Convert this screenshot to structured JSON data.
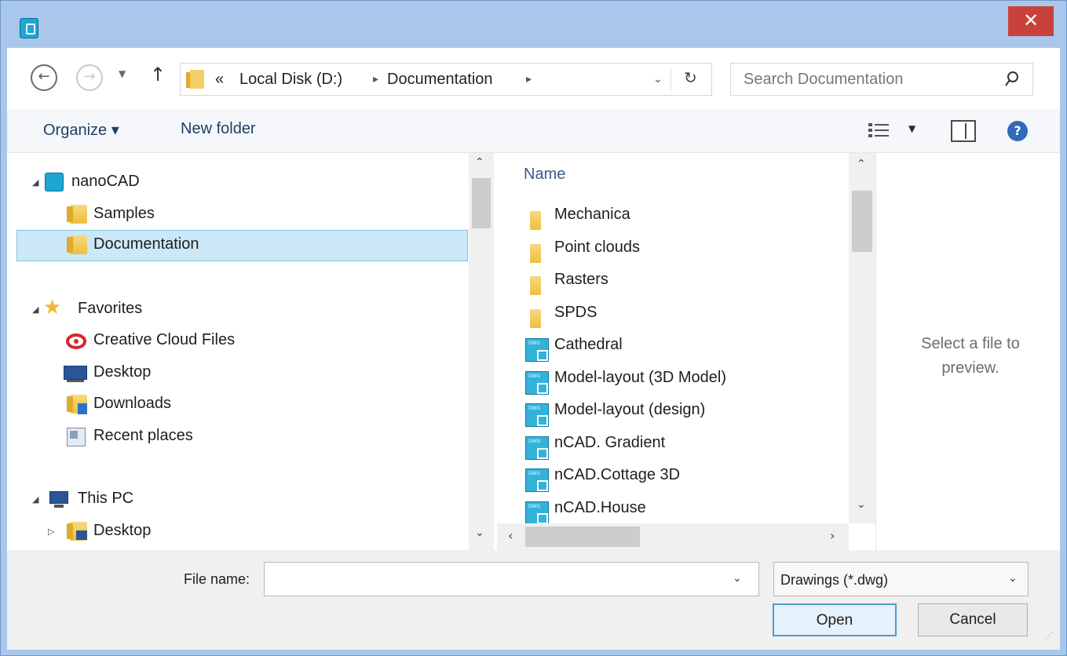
{
  "window": {
    "close_label": "✕"
  },
  "address": {
    "prefix": "«",
    "segments": [
      "Local Disk (D:)",
      "Documentation"
    ],
    "search_placeholder": "Search Documentation"
  },
  "toolbar": {
    "organize": "Organize ▾",
    "new_folder": "New folder"
  },
  "tree": [
    {
      "label": "nanoCAD",
      "arrow": "◢"
    },
    {
      "label": "Samples"
    },
    {
      "label": "Documentation",
      "selected": true
    },
    {
      "label": "Favorites",
      "arrow": "◢"
    },
    {
      "label": "Creative Cloud Files"
    },
    {
      "label": "Desktop"
    },
    {
      "label": "Downloads"
    },
    {
      "label": "Recent places"
    },
    {
      "label": "This PC",
      "arrow": "◢"
    },
    {
      "label": "Desktop",
      "arrow": "▷"
    }
  ],
  "files": {
    "column_header": "Name",
    "items": [
      {
        "name": "Mechanica",
        "type": "folder"
      },
      {
        "name": "Point clouds",
        "type": "folder"
      },
      {
        "name": "Rasters",
        "type": "folder"
      },
      {
        "name": "SPDS",
        "type": "folder"
      },
      {
        "name": "Cathedral",
        "type": "dwg"
      },
      {
        "name": "Model-layout (3D Model)",
        "type": "dwg"
      },
      {
        "name": "Model-layout (design)",
        "type": "dwg"
      },
      {
        "name": "nCAD. Gradient",
        "type": "dwg"
      },
      {
        "name": "nCAD.Cottage 3D",
        "type": "dwg"
      },
      {
        "name": "nCAD.House",
        "type": "dwg"
      }
    ]
  },
  "preview": {
    "message": "Select a file to preview."
  },
  "bottom": {
    "file_name_label": "File name:",
    "file_name_value": "",
    "file_type": "Drawings (*.dwg)",
    "open_label": "Open",
    "cancel_label": "Cancel"
  },
  "colors": {
    "titlebar": "#a9c7ea",
    "close": "#c9413b",
    "selection": "#cce8f6",
    "link": "#1e3f66"
  }
}
